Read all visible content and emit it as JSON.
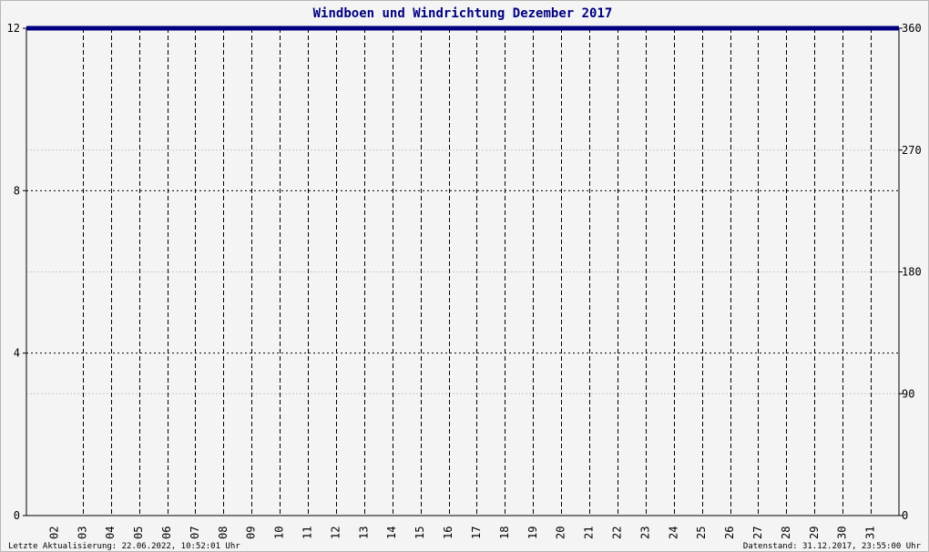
{
  "chart_data": {
    "type": "line",
    "title": "Windboen und Windrichtung Dezember 2017",
    "xlabel": "",
    "ylabel": "",
    "categories": [
      "02",
      "03",
      "04",
      "05",
      "06",
      "07",
      "08",
      "09",
      "10",
      "11",
      "12",
      "13",
      "14",
      "15",
      "16",
      "17",
      "18",
      "19",
      "20",
      "21",
      "22",
      "23",
      "24",
      "25",
      "26",
      "27",
      "28",
      "29",
      "30",
      "31"
    ],
    "y_left": {
      "range": [
        0,
        12
      ],
      "ticks": [
        0,
        4,
        8,
        12
      ]
    },
    "y_right": {
      "range": [
        0,
        360
      ],
      "ticks": [
        0,
        90,
        180,
        270,
        360
      ]
    },
    "grid": true,
    "series": [
      {
        "axis": "left",
        "values": [
          12,
          12,
          12,
          12,
          12,
          12,
          12,
          12,
          12,
          12,
          12,
          12,
          12,
          12,
          12,
          12,
          12,
          12,
          12,
          12,
          12,
          12,
          12,
          12,
          12,
          12,
          12,
          12,
          12,
          12
        ]
      }
    ],
    "colors": {
      "series": "#000080",
      "title": "#000080",
      "background": "#f4f4f4"
    }
  },
  "footer": {
    "left": "Letzte Aktualisierung: 22.06.2022, 10:52:01 Uhr",
    "right": "Datenstand: 31.12.2017, 23:55:00 Uhr"
  }
}
